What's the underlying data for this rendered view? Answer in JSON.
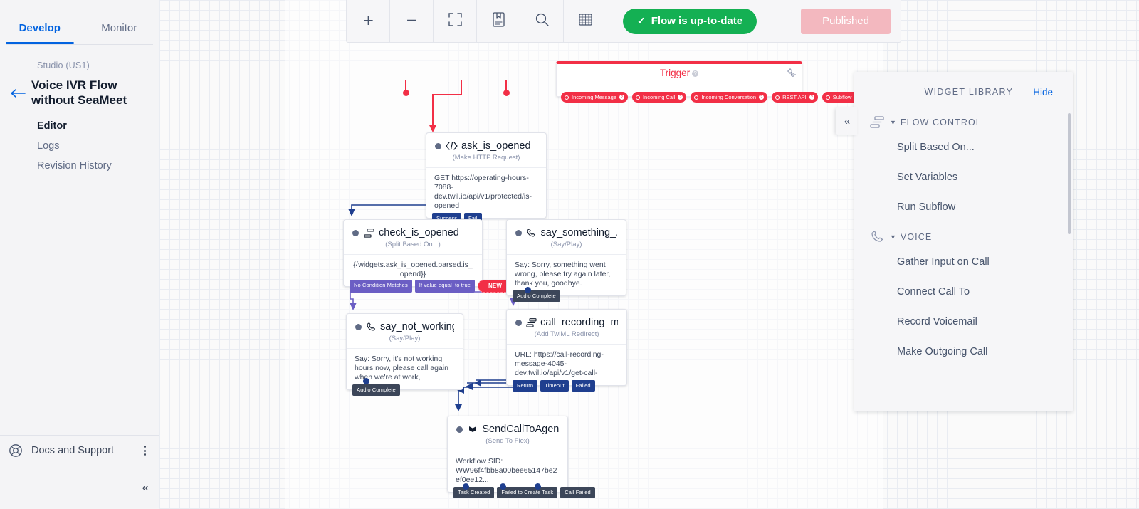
{
  "sidebar": {
    "tabs": [
      {
        "label": "Develop",
        "active": true
      },
      {
        "label": "Monitor",
        "active": false
      }
    ],
    "studio_label": "Studio (US1)",
    "flow_title": "Voice IVR Flow without SeaMeet",
    "links": [
      {
        "label": "Editor",
        "current": true
      },
      {
        "label": "Logs",
        "current": false
      },
      {
        "label": "Revision History",
        "current": false
      }
    ],
    "docs_label": "Docs and Support",
    "back_icon": "arrow-left-icon",
    "docs_icon": "life-ring-icon",
    "kebab_icon": "more-vertical-icon",
    "collapse_icon": "chevron-double-left-icon"
  },
  "toolbar": {
    "buttons": [
      {
        "name": "zoom-in-button",
        "glyph": "+"
      },
      {
        "name": "zoom-out-button",
        "glyph": "−"
      },
      {
        "name": "fit-to-screen-button",
        "glyph": "fit"
      },
      {
        "name": "flow-docs-button",
        "glyph": "book"
      },
      {
        "name": "search-button",
        "glyph": "search"
      },
      {
        "name": "grid-toggle-button",
        "glyph": "grid"
      }
    ],
    "status_label": "Flow is up-to-date",
    "status_check": "✓",
    "status_color": "#14b053",
    "published_label": "Published",
    "published_color": "#f3b8bf"
  },
  "trigger": {
    "title": "Trigger",
    "help_glyph": "?",
    "gear_icon": "gear-icon",
    "color": "#f22f46",
    "outputs": [
      {
        "label": "Incoming Message"
      },
      {
        "label": "Incoming Call"
      },
      {
        "label": "Incoming Conversation"
      },
      {
        "label": "REST API"
      },
      {
        "label": "Subflow"
      }
    ]
  },
  "nodes": [
    {
      "id": "ask_is_opened",
      "title": "ask_is_opened",
      "icon": "code-brackets-icon",
      "subtitle": "(Make HTTP Request)",
      "body": "GET https://operating-hours-7088-dev.twil.io/api/v1/protected/is-opened",
      "pills": [
        {
          "label": "Success",
          "style": "blue"
        },
        {
          "label": "Fail",
          "style": "blue"
        }
      ]
    },
    {
      "id": "check_is_opened",
      "title": "check_is_opened",
      "icon": "split-icon",
      "subtitle": "(Split Based On...)",
      "body": "{{widgets.ask_is_opened.parsed.is_opend}}",
      "pills": [
        {
          "label": "No Condition Matches",
          "style": "purple"
        },
        {
          "label": "If value equal_to true",
          "style": "purple"
        },
        {
          "label": "NEW",
          "style": "new"
        }
      ]
    },
    {
      "id": "say_something",
      "title": "say_something_...",
      "icon": "phone-say-icon",
      "subtitle": "(Say/Play)",
      "body": "Say: Sorry, something went wrong, please try again later, thank you, goodbye.",
      "pills": [
        {
          "label": "Audio Complete",
          "style": "dark"
        }
      ]
    },
    {
      "id": "say_not_working",
      "title": "say_not_working...",
      "icon": "phone-say-icon",
      "subtitle": "(Say/Play)",
      "body": "Say: Sorry, it's not working hours now, please call again when we're at work,",
      "pills": [
        {
          "label": "Audio Complete",
          "style": "dark"
        }
      ]
    },
    {
      "id": "call_recording_m",
      "title": "call_recording_m...",
      "icon": "split-icon",
      "subtitle": "(Add TwiML Redirect)",
      "body": "URL: https://call-recording-message-4045-dev.twil.io/api/v1/get-call-",
      "pills": [
        {
          "label": "Return",
          "style": "blue"
        },
        {
          "label": "Timeout",
          "style": "blue"
        },
        {
          "label": "Failed",
          "style": "blue"
        }
      ]
    },
    {
      "id": "SendCallToAgent",
      "title": "SendCallToAgent",
      "icon": "flex-flag-icon",
      "subtitle": "(Send To Flex)",
      "body": "Workflow SID: WW96f4fbb8a00bee65147be2ef0ee12...",
      "pills": [
        {
          "label": "Task Created",
          "style": "dark"
        },
        {
          "label": "Failed to Create Task",
          "style": "dark"
        },
        {
          "label": "Call Failed",
          "style": "dark"
        }
      ]
    }
  ],
  "widget_library": {
    "title": "WIDGET LIBRARY",
    "hide_label": "Hide",
    "collapse_icon": "chevron-double-left-icon",
    "groups": [
      {
        "label": "FLOW CONTROL",
        "icon": "flow-control-icon",
        "caret": "▼",
        "items": [
          "Split Based On...",
          "Set Variables",
          "Run Subflow"
        ]
      },
      {
        "label": "VOICE",
        "icon": "phone-icon",
        "caret": "▼",
        "items": [
          "Gather Input on Call",
          "Connect Call To",
          "Record Voicemail",
          "Make Outgoing Call"
        ]
      }
    ]
  }
}
